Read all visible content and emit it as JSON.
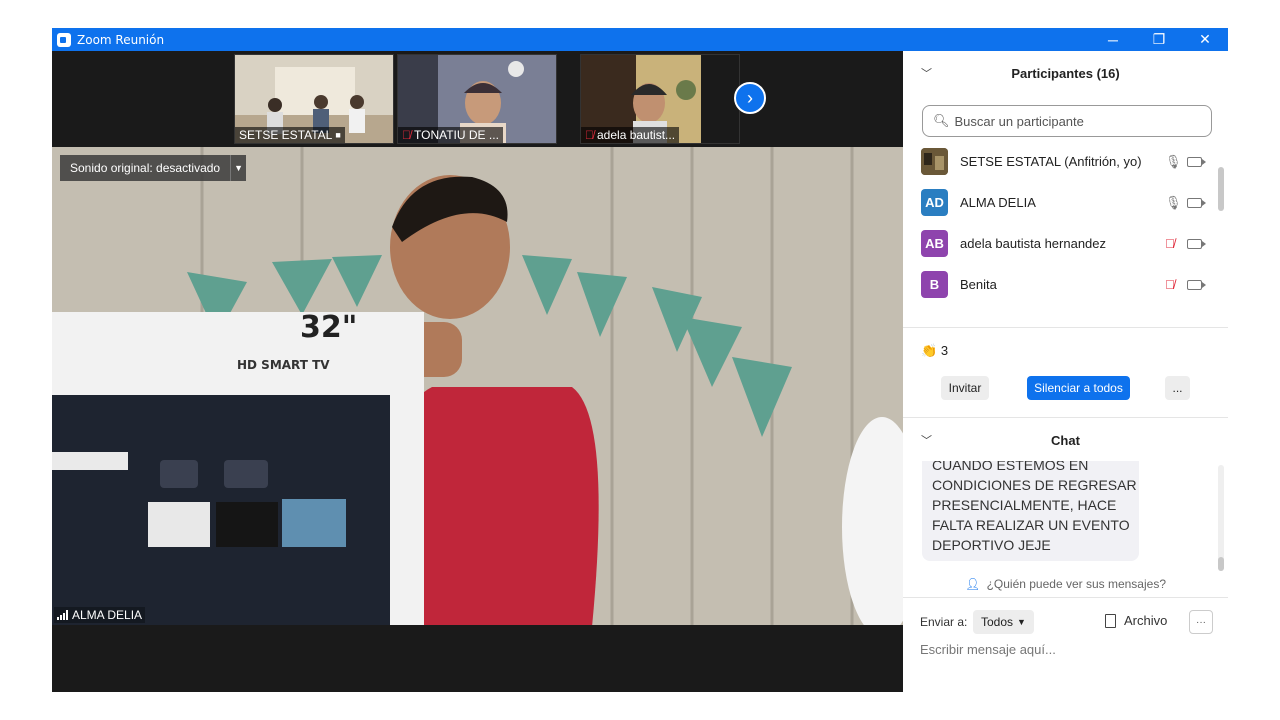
{
  "window": {
    "title": "Zoom Reunión"
  },
  "window_controls": {
    "minimize": "─",
    "restore": "❐",
    "close": "✕"
  },
  "thumbnails": [
    {
      "name": "SETSE ESTATAL",
      "muted": false
    },
    {
      "name": "TONATIU DE ...",
      "muted": true
    },
    {
      "name": "adela bautist...",
      "muted": true
    }
  ],
  "next_icon": "›",
  "main_video": {
    "sound_label": "Sonido original: desactivado",
    "speaker_name": "ALMA DELIA",
    "tv_box_text": {
      "size": "32\"",
      "model": "HD SMART TV"
    }
  },
  "participants": {
    "header": "Participantes (16)",
    "search_placeholder": "Buscar un participante",
    "list": [
      {
        "name": "SETSE ESTATAL (Anfitrión, yo)",
        "initials": "",
        "color": "#5a4a2e",
        "mic_muted": false
      },
      {
        "name": "ALMA DELIA",
        "initials": "AD",
        "color": "#2a7ec1",
        "mic_muted": false
      },
      {
        "name": "adela bautista hernandez",
        "initials": "AB",
        "color": "#8e44ad",
        "mic_muted": true
      },
      {
        "name": "Benita",
        "initials": "B",
        "color": "#8e44ad",
        "mic_muted": true
      }
    ],
    "reaction": {
      "icon": "👏",
      "count": "3"
    },
    "invite_label": "Invitar",
    "mute_all_label": "Silenciar a todos",
    "more_label": "..."
  },
  "chat": {
    "header": "Chat",
    "messages": [
      "CUANDO ESTEMOS EN CONDICIONES DE REGRESAR PRESENCIALMENTE, HACE FALTA REALIZAR UN EVENTO DEPORTIVO JEJE"
    ],
    "who_can_see": "¿Quién puede ver sus mensajes?",
    "send_to_label": "Enviar a:",
    "send_to_value": "Todos",
    "file_label": "Archivo",
    "more_label": "···",
    "compose_placeholder": "Escribir mensaje aquí..."
  },
  "colors": {
    "accent": "#0e72ed",
    "muted_red": "#e0293a"
  }
}
